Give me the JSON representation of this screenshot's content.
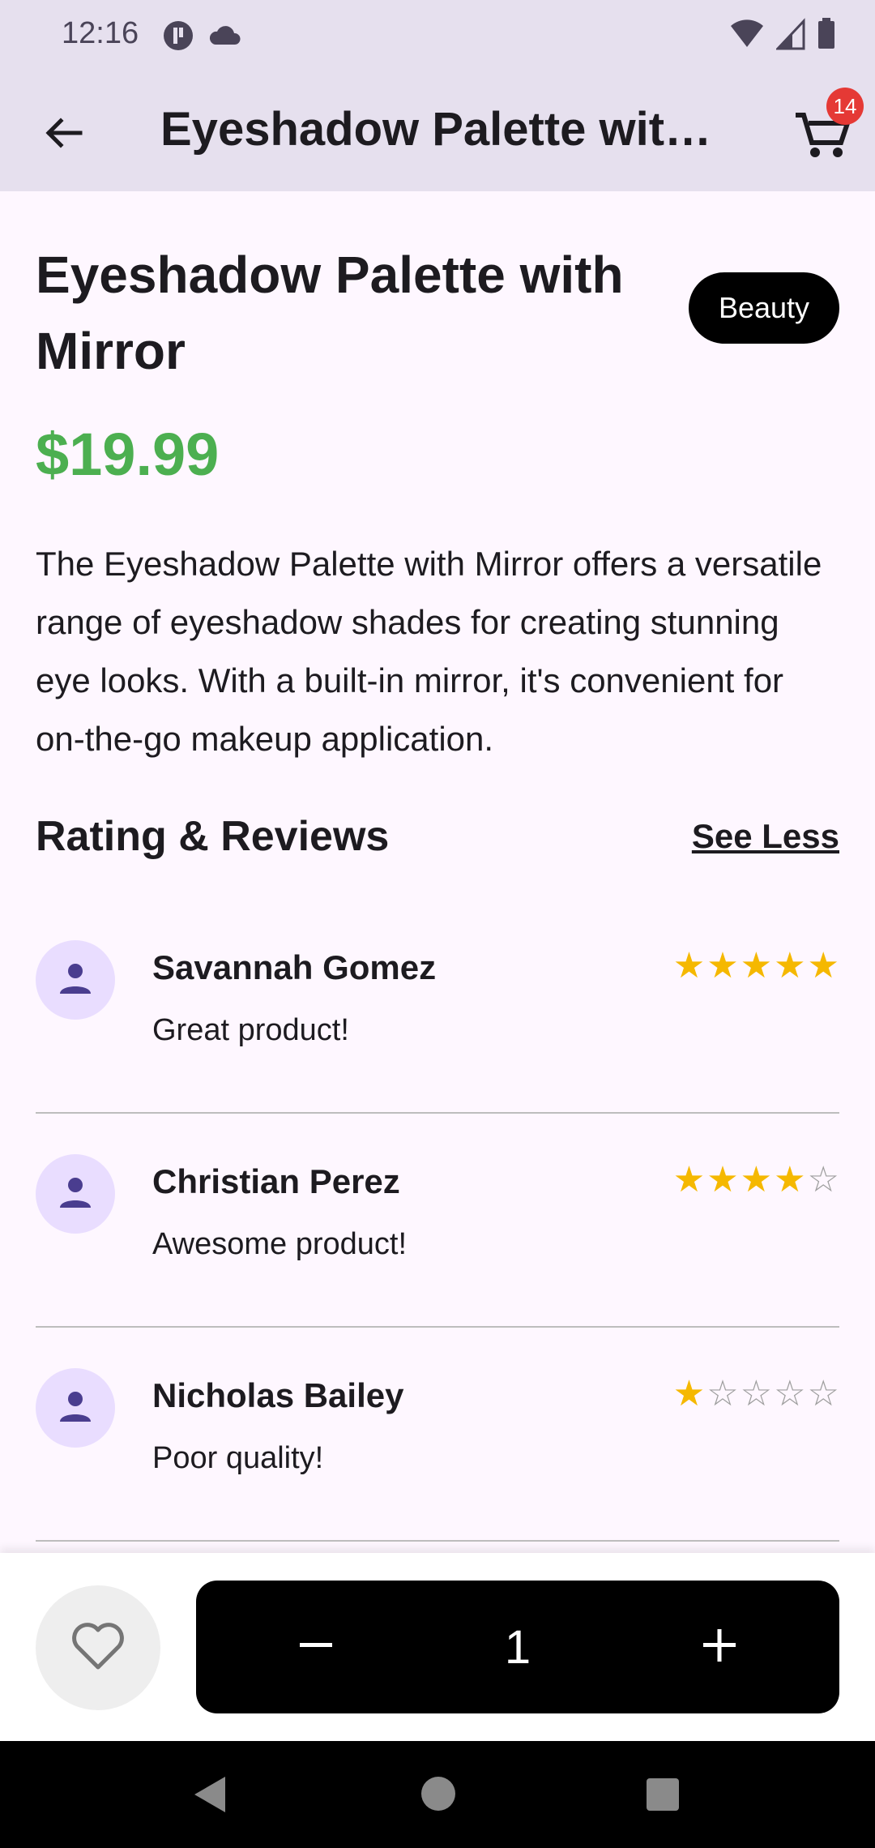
{
  "status_bar": {
    "time": "12:16",
    "icons_left": [
      "podcast-icon",
      "cloud-icon"
    ],
    "icons_right": [
      "wifi-icon",
      "signal-icon",
      "battery-icon"
    ]
  },
  "app_bar": {
    "title": "Eyeshadow Palette with Mirror",
    "back_icon": "arrow-back-icon",
    "cart_icon": "cart-icon",
    "cart_count": "14"
  },
  "product": {
    "title": "Eyeshadow Palette with Mirror",
    "category": "Beauty",
    "price": "$19.99",
    "description": "The Eyeshadow Palette with Mirror offers a versatile range of eyeshadow shades for creating stunning eye looks. With a built-in mirror, it's convenient for on-the-go makeup application."
  },
  "reviews_section": {
    "title": "Rating & Reviews",
    "toggle_label": "See Less",
    "reviews": [
      {
        "name": "Savannah Gomez",
        "text": "Great product!",
        "rating": 5
      },
      {
        "name": "Christian Perez",
        "text": "Awesome product!",
        "rating": 4
      },
      {
        "name": "Nicholas Bailey",
        "text": "Poor quality!",
        "rating": 1
      }
    ]
  },
  "bottom_bar": {
    "favorite_icon": "heart-outline-icon",
    "minus_icon": "minus-icon",
    "plus_icon": "plus-icon",
    "quantity": "1"
  },
  "colors": {
    "price": "#4caf50",
    "star": "#f5b800",
    "badge": "#e53935",
    "app_bar": "#e6e0ee"
  }
}
